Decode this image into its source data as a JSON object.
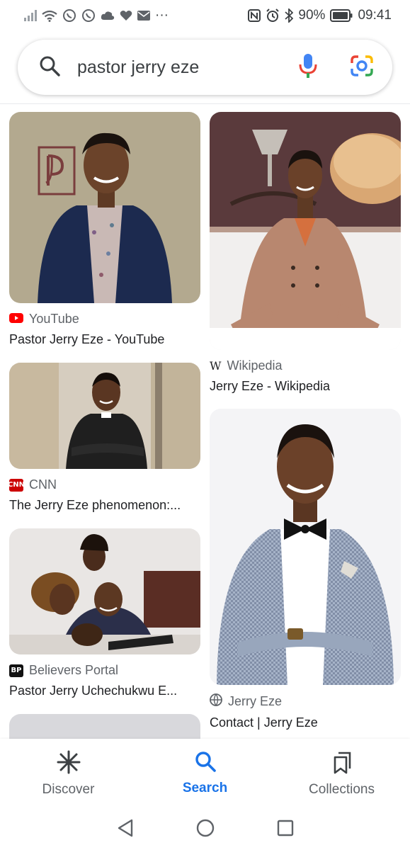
{
  "status_bar": {
    "battery": "90%",
    "time": "09:41",
    "more": "···"
  },
  "search": {
    "query": "pastor jerry eze"
  },
  "results": [
    {
      "source": "YouTube",
      "title": "Pastor Jerry Eze - YouTube",
      "favicon": "youtube-icon",
      "favicon_color": "#ff0000"
    },
    {
      "source": "Wikipedia",
      "title": "Jerry Eze - Wikipedia",
      "favicon": "wikipedia-icon",
      "favicon_color": "#000000"
    },
    {
      "source": "CNN",
      "title": "The Jerry Eze phenomenon:...",
      "favicon": "cnn-icon",
      "favicon_color": "#cc0000",
      "favicon_text": "CNN"
    },
    {
      "source": "Jerry Eze",
      "title": "Contact | Jerry Eze",
      "favicon": "globe-icon",
      "favicon_color": "#5f6368"
    },
    {
      "source": "Believers Portal",
      "title": "Pastor Jerry Uchechukwu E...",
      "favicon": "believers-portal-icon",
      "favicon_color": "#111111",
      "favicon_text": "BP"
    }
  ],
  "bottom_nav": {
    "items": [
      {
        "label": "Discover",
        "icon": "asterisk-icon"
      },
      {
        "label": "Search",
        "icon": "search-icon",
        "active": true
      },
      {
        "label": "Collections",
        "icon": "collections-icon"
      }
    ]
  },
  "colors": {
    "accent": "#1a73e8",
    "mic_blue": "#4285f4",
    "mic_red": "#ea4335",
    "lens_yellow": "#fbbc04",
    "lens_green": "#34a853"
  }
}
